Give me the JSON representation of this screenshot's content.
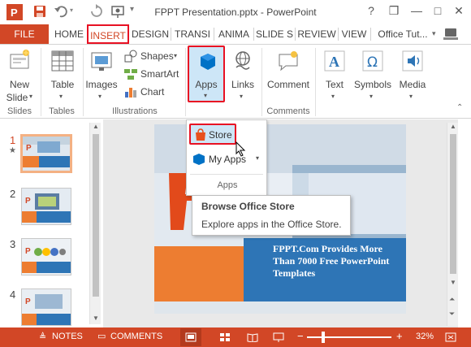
{
  "window": {
    "title": "FPPT Presentation.pptx - PowerPoint",
    "help": "?",
    "restore": "❒",
    "minimize": "—",
    "maximize": "□",
    "close": "✕"
  },
  "tabs": {
    "file": "FILE",
    "home": "HOME",
    "insert": "INSERT",
    "design": "DESIGN",
    "transitions": "TRANSI",
    "animations": "ANIMA",
    "slideshow": "SLIDE S",
    "review": "REVIEW",
    "view": "VIEW",
    "account": "Office Tut..."
  },
  "ribbon": {
    "new_slide_1": "New",
    "new_slide_2": "Slide",
    "table": "Table",
    "images": "Images",
    "shapes": "Shapes",
    "smartart": "SmartArt",
    "chart": "Chart",
    "apps": "Apps",
    "links": "Links",
    "comment": "Comment",
    "text": "Text",
    "symbols": "Symbols",
    "media": "Media",
    "groups": {
      "slides": "Slides",
      "tables": "Tables",
      "illustrations": "Illustrations",
      "comments": "Comments"
    }
  },
  "slides_pane": {
    "numbers": [
      "1",
      "2",
      "3",
      "4"
    ],
    "star": "★"
  },
  "apps_menu": {
    "store": "Store",
    "my_apps": "My Apps",
    "group": "Apps"
  },
  "tooltip": {
    "title": "Browse Office Store",
    "body": "Explore apps in the Office Store."
  },
  "slide": {
    "caption": "FPPT.Com Provides More Than 7000 Free PowerPoint Templates"
  },
  "statusbar": {
    "notes": "NOTES",
    "comments": "COMMENTS",
    "zoom": "32%",
    "zoom_minus": "−",
    "zoom_plus": "+"
  },
  "colors": {
    "accent": "#d24726",
    "highlight": "#e81123",
    "slide_blue": "#2e75b6",
    "slide_orange": "#ed7d31"
  }
}
